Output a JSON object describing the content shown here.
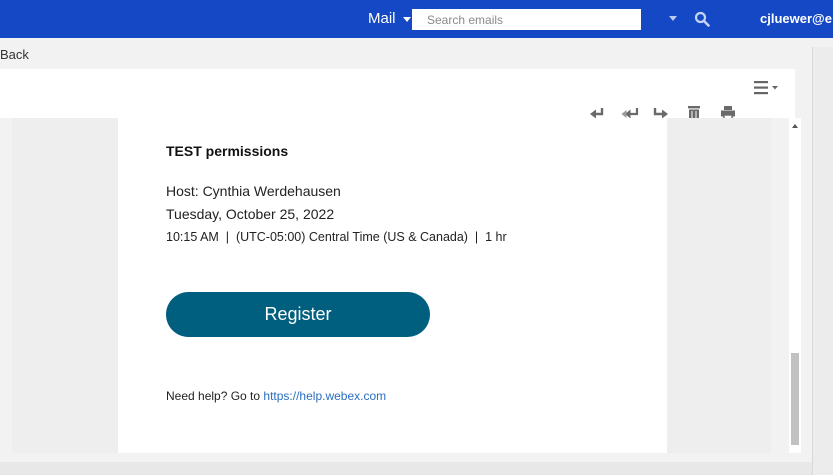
{
  "topbar": {
    "mail_label": "Mail",
    "search_placeholder": "Search emails",
    "user": "cjluewer@e"
  },
  "nav": {
    "back_label": "Back"
  },
  "email": {
    "title": "TEST permissions",
    "host": "Host: Cynthia Werdehausen",
    "date": "Tuesday, October 25, 2022",
    "time": "10:15 AM  |  (UTC-05:00) Central Time (US & Canada)  |  1 hr",
    "register_label": "Register",
    "help_text": "Need help? Go to ",
    "help_link": "https://help.webex.com"
  },
  "toolbar": {
    "icons": [
      "reply-icon",
      "reply-all-icon",
      "forward-icon",
      "delete-icon",
      "print-icon",
      "menu-icon"
    ]
  },
  "colors": {
    "topbar": "#1448c4",
    "register_button": "#005e7e",
    "link": "#2a6ebd",
    "toolbar_icon": "#6a6a6a"
  }
}
